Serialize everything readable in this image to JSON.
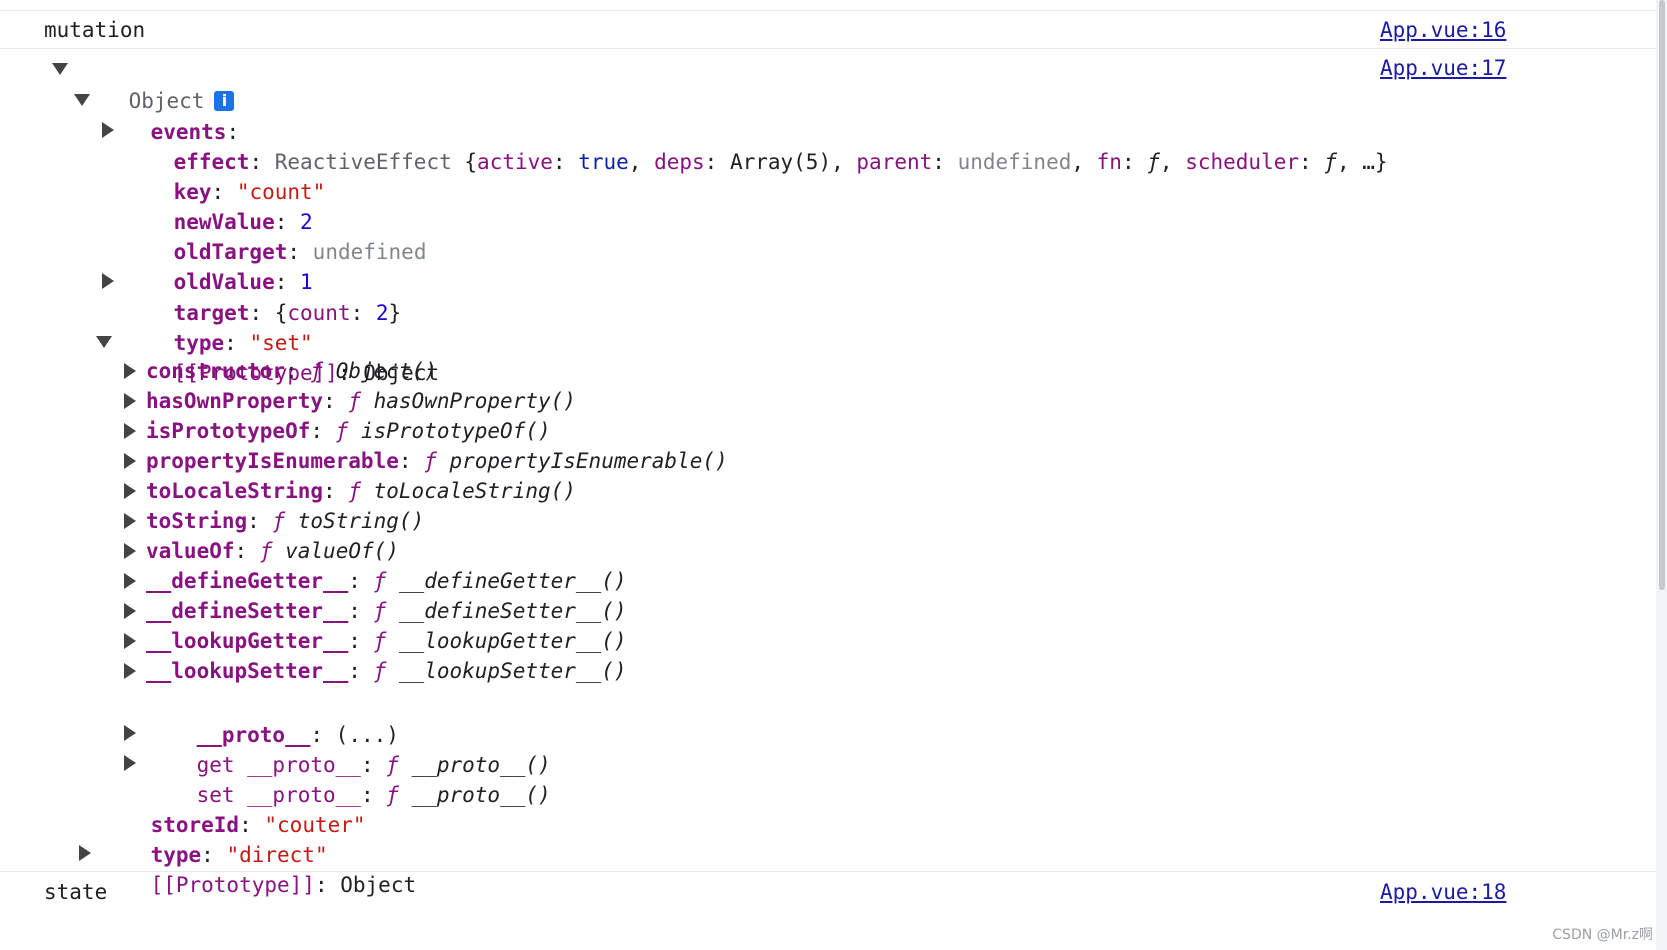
{
  "log1": {
    "label": "mutation",
    "source": "App.vue:16"
  },
  "log2": {
    "label": "Object",
    "source": "App.vue:17",
    "info_badge": "i"
  },
  "events": {
    "label": "events",
    "effect": {
      "key": "effect",
      "class_name": "ReactiveEffect",
      "preview": [
        "active",
        "true",
        "deps",
        "Array(5)",
        "parent",
        "undefined",
        "fn",
        "ƒ",
        "scheduler",
        "ƒ",
        "…"
      ]
    },
    "key": {
      "key": "key",
      "value": "\"count\""
    },
    "newValue": {
      "key": "newValue",
      "value": "2"
    },
    "oldTarget": {
      "key": "oldTarget",
      "value": "undefined"
    },
    "oldValue": {
      "key": "oldValue",
      "value": "1"
    },
    "target": {
      "key": "target",
      "preview_key": "count",
      "preview_value": "2"
    },
    "type": {
      "key": "type",
      "value": "\"set\""
    },
    "prototype": {
      "key": "[[Prototype]]",
      "value": "Object"
    }
  },
  "proto_items": [
    {
      "key": "constructor",
      "fn": "Object()"
    },
    {
      "key": "hasOwnProperty",
      "fn": "hasOwnProperty()"
    },
    {
      "key": "isPrototypeOf",
      "fn": "isPrototypeOf()"
    },
    {
      "key": "propertyIsEnumerable",
      "fn": "propertyIsEnumerable()"
    },
    {
      "key": "toLocaleString",
      "fn": "toLocaleString()"
    },
    {
      "key": "toString",
      "fn": "toString()"
    },
    {
      "key": "valueOf",
      "fn": "valueOf()"
    },
    {
      "key": "__defineGetter__",
      "fn": "__defineGetter__()"
    },
    {
      "key": "__defineSetter__",
      "fn": "__defineSetter__()"
    },
    {
      "key": "__lookupGetter__",
      "fn": "__lookupGetter__()"
    },
    {
      "key": "__lookupSetter__",
      "fn": "__lookupSetter__()"
    }
  ],
  "proto_tail": {
    "proto": {
      "key": "__proto__",
      "value": "(...)"
    },
    "get_proto": {
      "prefix": "get __proto__",
      "fn": "__proto__()"
    },
    "set_proto": {
      "prefix": "set __proto__",
      "fn": "__proto__()"
    }
  },
  "storeId": {
    "key": "storeId",
    "value": "\"couter\""
  },
  "outer_type": {
    "key": "type",
    "value": "\"direct\""
  },
  "outer_prototype": {
    "key": "[[Prototype]]",
    "value": "Object"
  },
  "log3": {
    "label": "state",
    "source": "App.vue:18"
  },
  "fn_symbol": "ƒ",
  "watermark": "CSDN @Mr.z啊"
}
